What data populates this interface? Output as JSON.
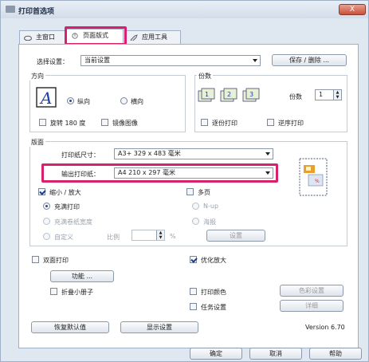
{
  "window": {
    "title": "打印首选项",
    "close_label": "X"
  },
  "tabs": [
    {
      "label": "主窗口"
    },
    {
      "label": "页面版式"
    },
    {
      "label": "应用工具"
    }
  ],
  "settings": {
    "label": "选择设置：",
    "value": "当前设置",
    "save_delete": "保存 / 删除 ..."
  },
  "orientation": {
    "title": "方向",
    "portrait": "纵向",
    "landscape": "横向",
    "rotate180": "旋转 180 度",
    "mirror": "镜像图像"
  },
  "copies": {
    "title": "份数",
    "label": "份数",
    "value": "1",
    "collate": "逐份打印",
    "reverse": "逆序打印"
  },
  "layout": {
    "title": "版面",
    "paper_size_label": "打印纸尺寸：",
    "paper_size_value": "A3+ 329 x 483 毫米",
    "output_paper_label": "输出打印纸：",
    "output_paper_value": "A4 210 x 297 毫米"
  },
  "reduce_enlarge": {
    "label": "缩小 / 放大",
    "fit_page": "充满打印",
    "fit_roll": "充满卷纸宽度",
    "custom": "自定义",
    "scale_label": "比例",
    "percent": "%"
  },
  "multipage": {
    "label": "多页",
    "nup": "N-up",
    "poster": "海报",
    "settings": "设置"
  },
  "duplex": {
    "label": "双面打印",
    "function": "功能 ...",
    "folded_booklet": "折叠小册子"
  },
  "optimize": {
    "label": "优化放大"
  },
  "print_color": {
    "label": "打印颜色",
    "button": "色彩设置"
  },
  "job_settings": {
    "label": "任务设置",
    "button": "详细"
  },
  "bottom": {
    "restore": "恢复默认值",
    "show_settings": "显示设置",
    "version": "Version 6.70"
  },
  "dialog": {
    "ok": "确定",
    "cancel": "取消",
    "help": "帮助"
  }
}
